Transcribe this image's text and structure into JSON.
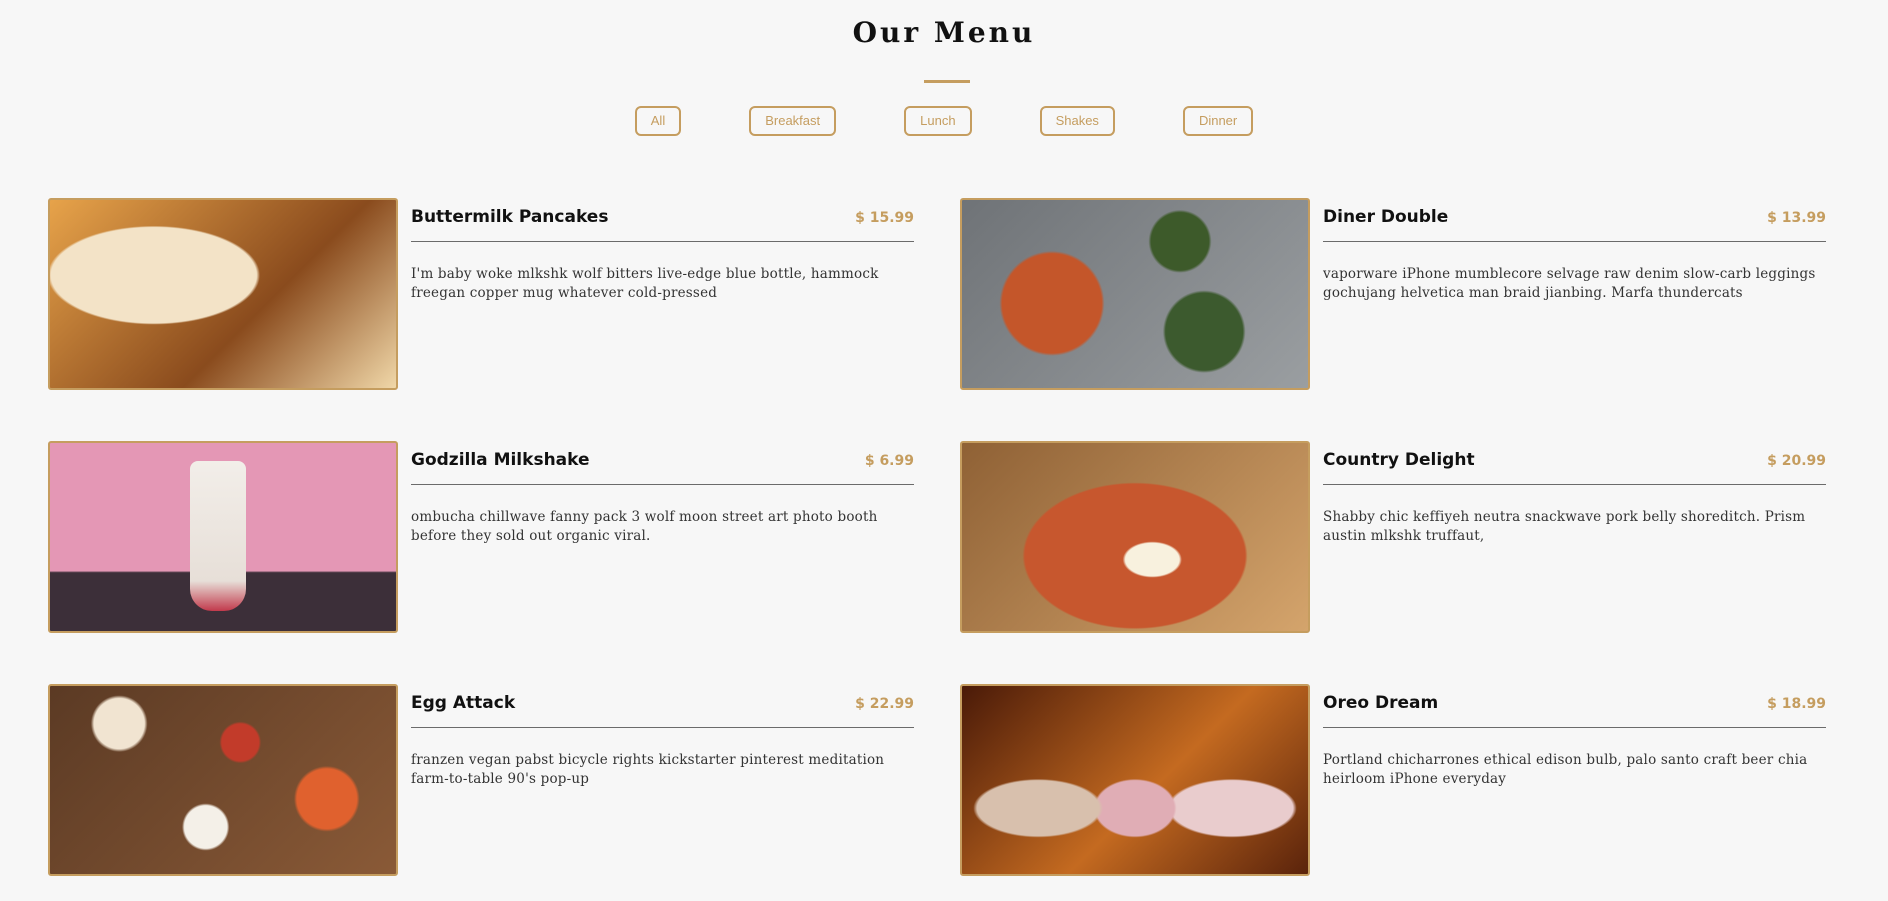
{
  "header": {
    "title": "Our Menu"
  },
  "filters": [
    "All",
    "Breakfast",
    "Lunch",
    "Shakes",
    "Dinner"
  ],
  "colors": {
    "accent": "#c59d5f",
    "background": "#f7f7f7",
    "divider": "#6b6b6b"
  },
  "items": [
    {
      "name": "Buttermilk Pancakes",
      "price": "$ 15.99",
      "desc": "I'm baby woke mlkshk wolf bitters live-edge blue bottle, hammock freegan copper mug whatever cold-pressed"
    },
    {
      "name": "Diner Double",
      "price": "$ 13.99",
      "desc": "vaporware iPhone mumblecore selvage raw denim slow-carb leggings gochujang helvetica man braid jianbing. Marfa thundercats"
    },
    {
      "name": "Godzilla Milkshake",
      "price": "$ 6.99",
      "desc": "ombucha chillwave fanny pack 3 wolf moon street art photo booth before they sold out organic viral."
    },
    {
      "name": "Country Delight",
      "price": "$ 20.99",
      "desc": "Shabby chic keffiyeh neutra snackwave pork belly shoreditch. Prism austin mlkshk truffaut,"
    },
    {
      "name": "Egg Attack",
      "price": "$ 22.99",
      "desc": "franzen vegan pabst bicycle rights kickstarter pinterest meditation farm-to-table 90's pop-up"
    },
    {
      "name": "Oreo Dream",
      "price": "$ 18.99",
      "desc": "Portland chicharrones ethical edison bulb, palo santo craft beer chia heirloom iPhone everyday"
    }
  ]
}
